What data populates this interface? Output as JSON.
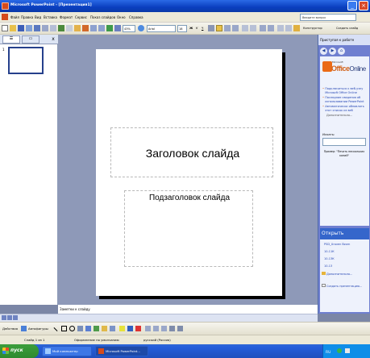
{
  "window": {
    "title": "Microsoft PowerPoint - [Презентация1]",
    "minimize_glyph": "_",
    "close_glyph": "×"
  },
  "menu": {
    "items": [
      "Файл",
      "Правка",
      "Вид",
      "Вставка",
      "Формат",
      "Сервис",
      "Показ слайдов",
      "Окно",
      "Справка"
    ],
    "help_placeholder": "Введите вопрос"
  },
  "toolbar": {
    "zoom": "43%",
    "font": "Arial",
    "font_size": "18",
    "design_label": "Конструктор",
    "new_slide_label": "Создать слайд"
  },
  "outline_pane": {
    "close_glyph": "x",
    "slide_number": "1"
  },
  "slide": {
    "title": "Заголовок слайда",
    "subtitle": "Подзаголовок слайда"
  },
  "notes": {
    "placeholder": "Заметки к слайду"
  },
  "task_pane": {
    "header": "Приступая к работе",
    "logo_small": "Microsoft",
    "logo_office": "Office",
    "logo_online": "Online",
    "links": [
      "Подключиться к веб-узлу Microsoft Office Online",
      "Последние сведения об использовании PowerPoint",
      "Автоматически обновлять этот список из веб"
    ],
    "more": "Дополнительно...",
    "search_label": "Искать:",
    "search_example": "Пример: \"Печать нескольких копий\"",
    "open_section": "Открыть",
    "recent_files": [
      "PSD_Uroven Bzorn",
      "10-11К",
      "10-13К",
      "10-13"
    ],
    "open_more": "Дополнительно...",
    "create_new": "Создать презентацию..."
  },
  "drawing_toolbar": {
    "actions_label": "Действия",
    "autoshapes_label": "Автофигуры"
  },
  "status_bar": {
    "slide_info": "Слайд 1 из 1",
    "design": "Оформление по умолчанию",
    "language": "русский (Россия)"
  },
  "taskbar": {
    "start_label": "пуск",
    "tasks": [
      "Мой компьютер",
      "Microsoft PowerPoint..."
    ],
    "clock": "RU"
  },
  "colors": {
    "title_bar": "#0a3fbf",
    "task_pane": "#6f7fd0",
    "office_orange": "#ea6a16",
    "taskbar": "#245edb",
    "start_green": "#3c9e3c"
  }
}
